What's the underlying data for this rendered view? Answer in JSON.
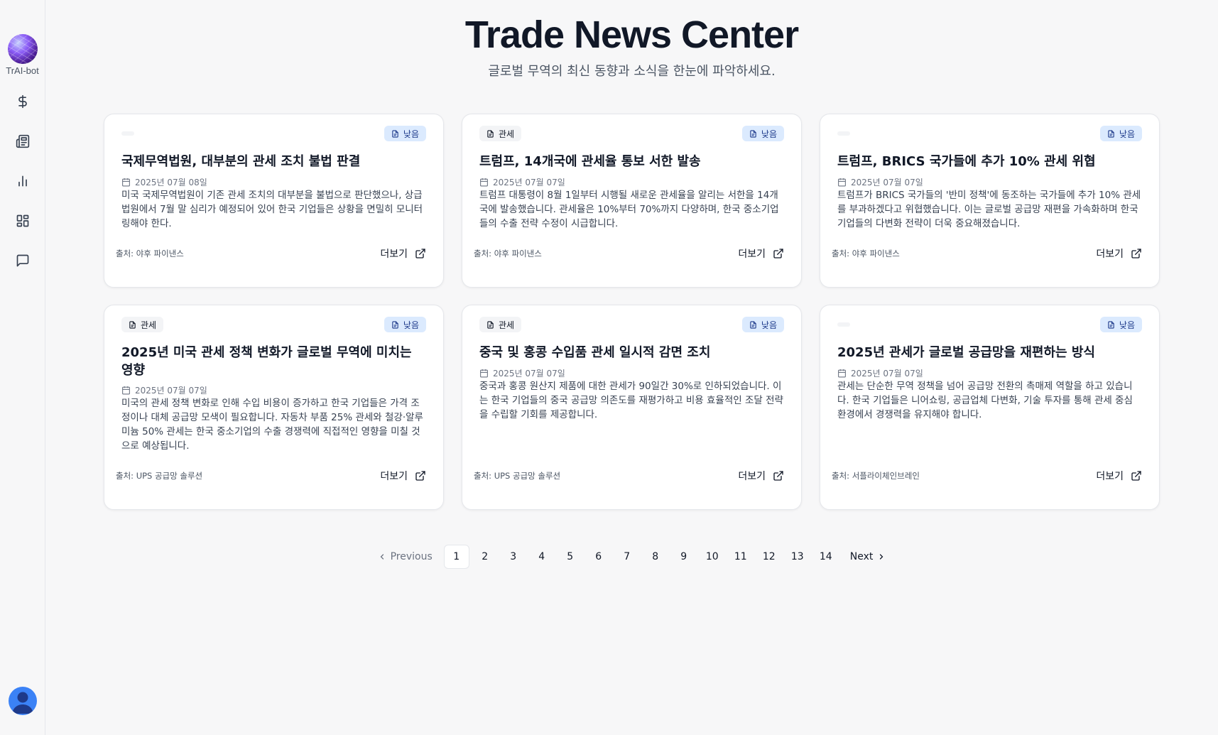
{
  "sidebar": {
    "logo_label": "TrAI-bot",
    "nav": [
      {
        "icon": "dollar-icon"
      },
      {
        "icon": "newspaper-icon"
      },
      {
        "icon": "bar-chart-icon"
      },
      {
        "icon": "dashboard-icon"
      },
      {
        "icon": "message-icon"
      }
    ]
  },
  "header": {
    "title": "Trade News Center",
    "subtitle": "글로벌 무역의 최신 동향과 소식을 한눈에 파악하세요."
  },
  "cards": [
    {
      "category": "",
      "priority": "낮음",
      "title": "국제무역법원, 대부분의 관세 조치 불법 판결",
      "date": "2025년 07월 08일",
      "description": "미국 국제무역법원이 기존 관세 조치의 대부분을 불법으로 판단했으나, 상급법원에서 7월 말 심리가 예정되어 있어 한국 기업들은 상황을 면밀히 모니터링해야 한다.",
      "source": "출처: 야후 파이낸스",
      "more_label": "더보기"
    },
    {
      "category": "관세",
      "priority": "낮음",
      "title": "트럼프, 14개국에 관세율 통보 서한 발송",
      "date": "2025년 07월 07일",
      "description": "트럼프 대통령이 8월 1일부터 시행될 새로운 관세율을 알리는 서한을 14개국에 발송했습니다. 관세율은 10%부터 70%까지 다양하며, 한국 중소기업들의 수출 전략 수정이 시급합니다.",
      "source": "출처: 야후 파이낸스",
      "more_label": "더보기"
    },
    {
      "category": "",
      "priority": "낮음",
      "title": "트럼프, BRICS 국가들에 추가 10% 관세 위협",
      "date": "2025년 07월 07일",
      "description": "트럼프가 BRICS 국가들의 '반미 정책'에 동조하는 국가들에 추가 10% 관세를 부과하겠다고 위협했습니다. 이는 글로벌 공급망 재편을 가속화하며 한국 기업들의 다변화 전략이 더욱 중요해졌습니다.",
      "source": "출처: 야후 파이낸스",
      "more_label": "더보기"
    },
    {
      "category": "관세",
      "priority": "낮음",
      "title": "2025년 미국 관세 정책 변화가 글로벌 무역에 미치는 영향",
      "date": "2025년 07월 07일",
      "description": "미국의 관세 정책 변화로 인해 수입 비용이 증가하고 한국 기업들은 가격 조정이나 대체 공급망 모색이 필요합니다. 자동차 부품 25% 관세와 철강·알루미늄 50% 관세는 한국 중소기업의 수출 경쟁력에 직접적인 영향을 미칠 것으로 예상됩니다.",
      "source": "출처: UPS 공급망 솔루션",
      "more_label": "더보기"
    },
    {
      "category": "관세",
      "priority": "낮음",
      "title": "중국 및 홍콩 수입품 관세 일시적 감면 조치",
      "date": "2025년 07월 07일",
      "description": "중국과 홍콩 원산지 제품에 대한 관세가 90일간 30%로 인하되었습니다. 이는 한국 기업들의 중국 공급망 의존도를 재평가하고 비용 효율적인 조달 전략을 수립할 기회를 제공합니다.",
      "source": "출처: UPS 공급망 솔루션",
      "more_label": "더보기"
    },
    {
      "category": "",
      "priority": "낮음",
      "title": "2025년 관세가 글로벌 공급망을 재편하는 방식",
      "date": "2025년 07월 07일",
      "description": "관세는 단순한 무역 정책을 넘어 공급망 전환의 촉매제 역할을 하고 있습니다. 한국 기업들은 니어쇼링, 공급업체 다변화, 기술 투자를 통해 관세 중심 환경에서 경쟁력을 유지해야 합니다.",
      "source": "출처: 서플라이체인브레인",
      "more_label": "더보기"
    }
  ],
  "pagination": {
    "prev_label": "Previous",
    "next_label": "Next",
    "pages": [
      "1",
      "2",
      "3",
      "4",
      "5",
      "6",
      "7",
      "8",
      "9",
      "10",
      "11",
      "12",
      "13",
      "14"
    ],
    "current": "1"
  },
  "colors": {
    "priority_bg": "#dbeafe",
    "priority_text": "#1e3a8a",
    "category_bg": "#f3f4f6",
    "avatar": "#3b82f6"
  }
}
